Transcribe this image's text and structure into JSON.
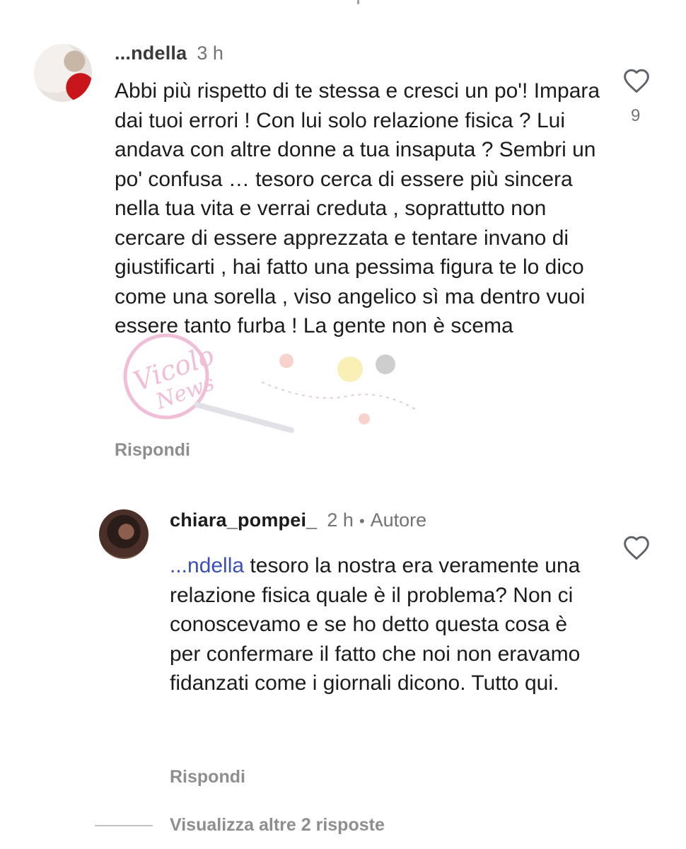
{
  "comments": [
    {
      "username": "...ndella",
      "time": "3 h",
      "text": "Abbi più rispetto di te stessa e cresci un po'! Impara dai tuoi errori ! Con lui solo relazione fisica ? Lui andava con altre donne a tua insaputa ? Sembri un po' confusa … tesoro cerca di essere più sincera nella tua vita e verrai creduta , soprattutto non cercare di essere apprezzata e tentare invano di giustificarti , hai fatto una pessima figura te lo dico come una sorella , viso angelico sì ma dentro vuoi essere tanto furba ! La gente non è scema",
      "likes": "9",
      "reply_label": "Rispondi"
    },
    {
      "username": "chiara_pompei_",
      "time": "2 h",
      "author_badge": "Autore",
      "mention": "...ndella",
      "text": "tesoro la nostra era veramente una relazione fisica quale è il problema? Non ci conoscevamo e se ho detto questa cosa è per confermare il fatto che noi non eravamo fidanzati come i giornali dicono. Tutto qui.",
      "reply_label": "Rispondi"
    }
  ],
  "view_more_replies": "Visualizza altre 2 risposte",
  "watermark": "Vicolo News",
  "icons": {
    "like": "heart-outline-icon"
  },
  "colors": {
    "mention": "#3b4fb8",
    "secondary_text": "#8e8e8e"
  }
}
